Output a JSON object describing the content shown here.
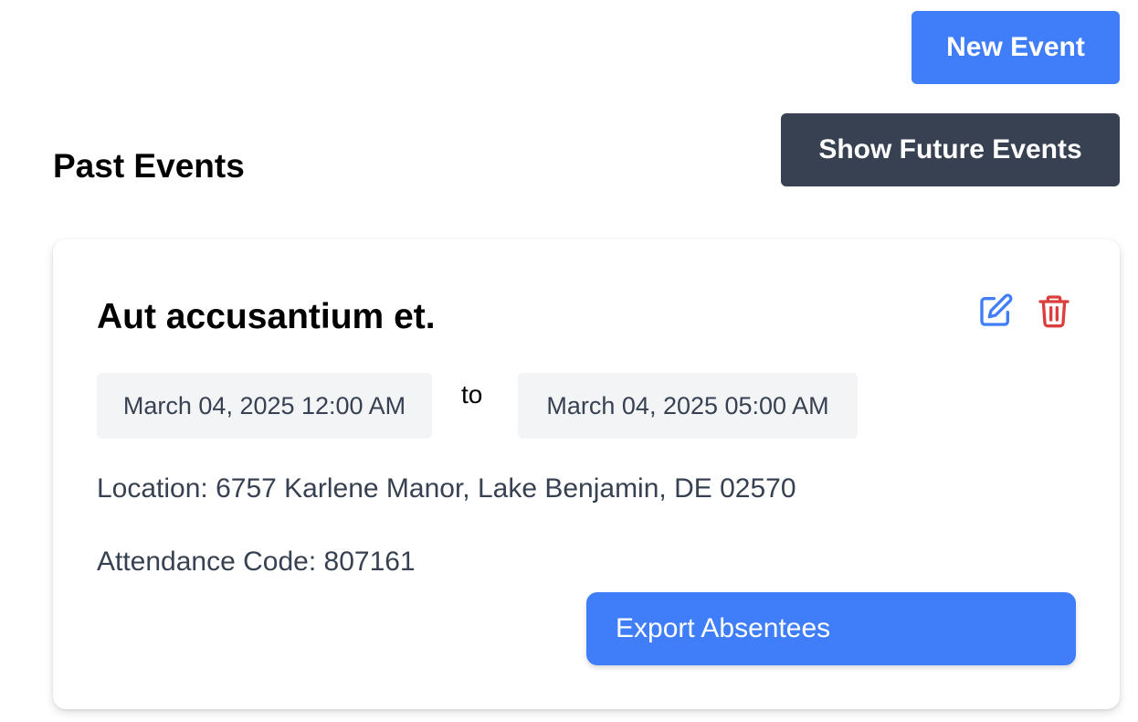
{
  "header": {
    "new_event_label": "New Event",
    "show_future_label": "Show Future Events"
  },
  "section": {
    "title": "Past Events"
  },
  "event": {
    "title": "Aut accusantium et.",
    "start": "March 04, 2025 12:00 AM",
    "separator": "to",
    "end": "March 04, 2025 05:00 AM",
    "location": "Location: 6757 Karlene Manor, Lake Benjamin, DE 02570",
    "attendance_code": "Attendance Code: 807161",
    "export_label": "Export Absentees",
    "icons": {
      "edit": "edit-icon",
      "delete": "trash-icon"
    }
  },
  "colors": {
    "primary": "#3f7ef8",
    "dark_button": "#374151",
    "danger": "#dc3d3d",
    "date_bg": "#f3f4f6",
    "muted_text": "#374151"
  }
}
